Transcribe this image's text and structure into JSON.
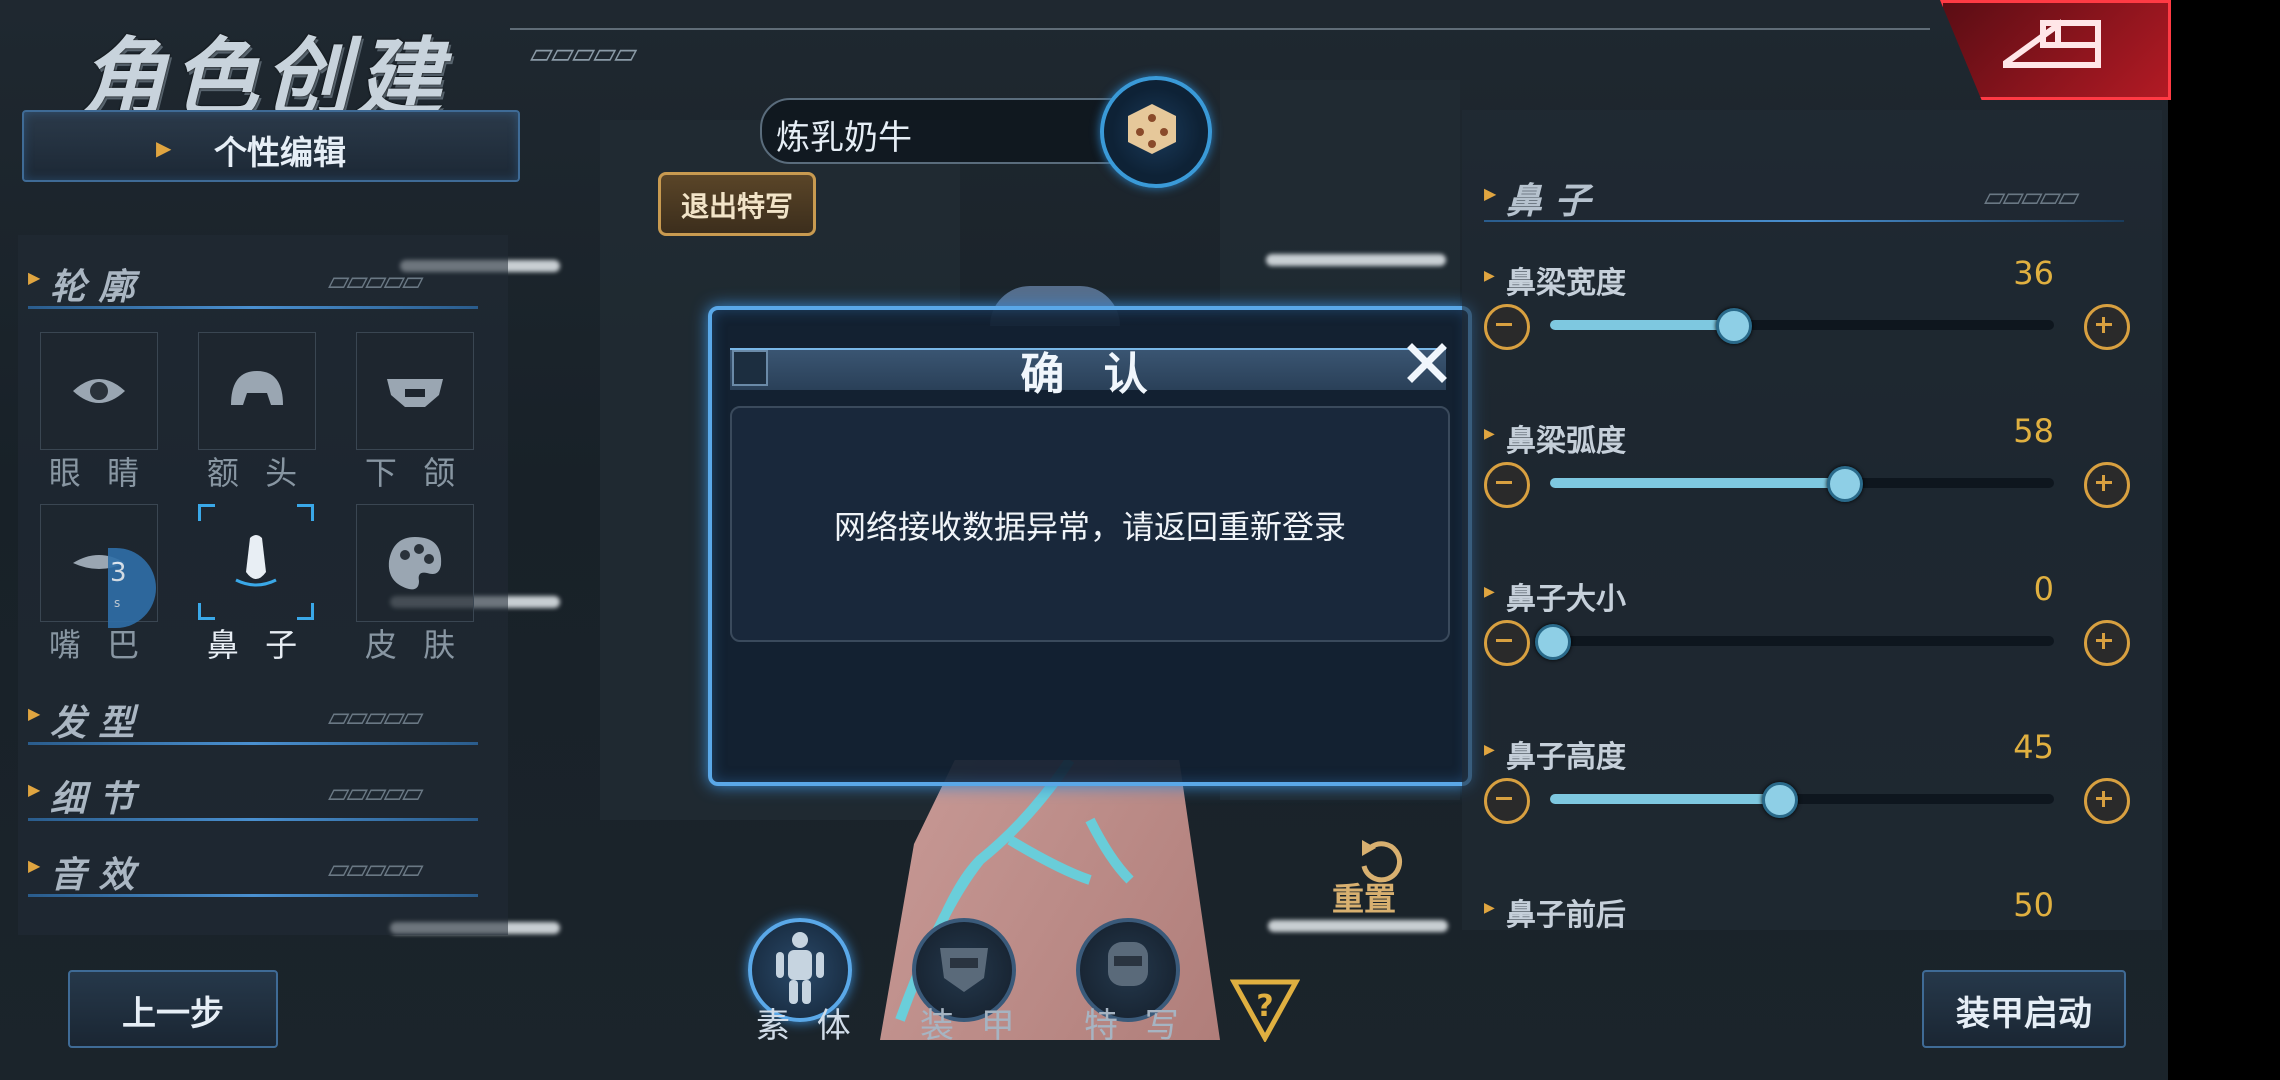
{
  "header": {
    "title": "角色创建",
    "back_icon": "back-arrow-icon"
  },
  "left_panel": {
    "edit_button": "个性编辑",
    "sections": [
      {
        "label": "轮 廓"
      },
      {
        "label": "发 型"
      },
      {
        "label": "细 节"
      },
      {
        "label": "音 效"
      }
    ],
    "tiles": [
      {
        "label": "眼 睛",
        "icon": "eye-icon"
      },
      {
        "label": "额 头",
        "icon": "forehead-icon"
      },
      {
        "label": "下 颌",
        "icon": "jaw-icon"
      },
      {
        "label": "嘴 巴",
        "icon": "mouth-icon"
      },
      {
        "label": "鼻 子",
        "icon": "nose-icon",
        "selected": true
      },
      {
        "label": "皮 肤",
        "icon": "palette-icon"
      }
    ],
    "badge": {
      "value": "3",
      "unit": "s"
    },
    "prev_button": "上一步"
  },
  "center": {
    "name_value": "炼乳奶牛",
    "exit_closeup": "退出特写",
    "reset": "重置",
    "nav": [
      {
        "label": "素 体",
        "icon": "body-icon"
      },
      {
        "label": "装 甲",
        "icon": "armor-icon"
      },
      {
        "label": "特 写",
        "icon": "closeup-icon"
      }
    ],
    "help_icon": "help-icon"
  },
  "dialog": {
    "title": "确 认",
    "message": "网络接收数据异常，请返回重新登录",
    "close_icon": "close-icon"
  },
  "right_panel": {
    "section": "鼻 子",
    "sliders": [
      {
        "label": "鼻梁宽度",
        "value": "36",
        "fraction": 0.36
      },
      {
        "label": "鼻梁弧度",
        "value": "58",
        "fraction": 0.58
      },
      {
        "label": "鼻子大小",
        "value": "0",
        "fraction": 0.0
      },
      {
        "label": "鼻子高度",
        "value": "45",
        "fraction": 0.45
      },
      {
        "label": "鼻子前后",
        "value": "50",
        "fraction": 0.5
      }
    ],
    "armor_button": "装甲启动"
  },
  "colors": {
    "accent_blue": "#5aa8e8",
    "gold": "#e0b040",
    "alert_red": "#c8202c"
  }
}
